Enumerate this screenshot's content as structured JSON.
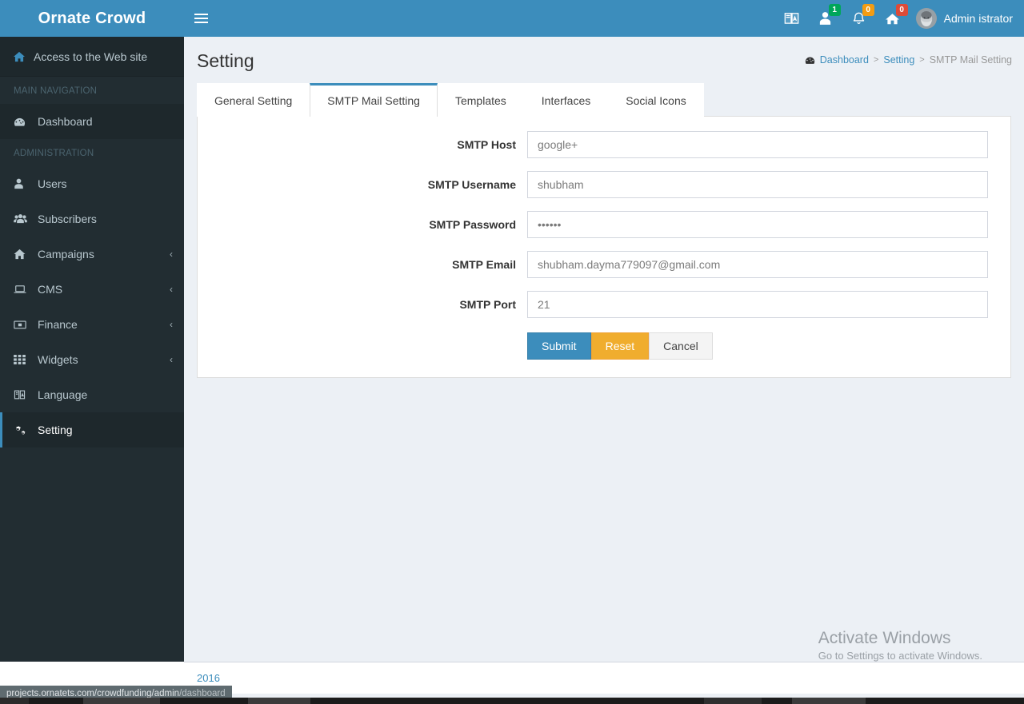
{
  "sidebar": {
    "brand": "Ornate Crowd",
    "web_access": {
      "label": "Access to the Web site",
      "icon": "home-icon"
    },
    "sections": [
      {
        "header": "MAIN NAVIGATION",
        "items": [
          {
            "label": "Dashboard",
            "icon": "dashboard-icon",
            "chevron": ""
          }
        ]
      },
      {
        "header": "ADMINISTRATION",
        "items": [
          {
            "label": "Users",
            "icon": "user-icon",
            "chevron": ""
          },
          {
            "label": "Subscribers",
            "icon": "users-group-icon",
            "chevron": ""
          },
          {
            "label": "Campaigns",
            "icon": "home-icon",
            "chevron": "‹"
          },
          {
            "label": "CMS",
            "icon": "laptop-icon",
            "chevron": "‹"
          },
          {
            "label": "Finance",
            "icon": "money-icon",
            "chevron": "‹"
          },
          {
            "label": "Widgets",
            "icon": "grid-icon",
            "chevron": "‹"
          },
          {
            "label": "Language",
            "icon": "language-icon",
            "chevron": ""
          },
          {
            "label": "Setting",
            "icon": "gears-icon",
            "chevron": "",
            "active": true
          }
        ]
      }
    ]
  },
  "navbar": {
    "menu_toggle_icon": "hamburger-icon",
    "icons": [
      {
        "name": "language-icon",
        "badge": null,
        "badge_color": null
      },
      {
        "name": "user-messages-icon",
        "badge": "1",
        "badge_color": "#00a65a"
      },
      {
        "name": "bell-icon",
        "badge": "0",
        "badge_color": "#f39c12"
      },
      {
        "name": "home-flag-icon",
        "badge": "0",
        "badge_color": "#dd4b39"
      }
    ],
    "user_name": "Admin istrator",
    "avatar_icon": "avatar"
  },
  "page": {
    "title": "Setting",
    "breadcrumb": {
      "home_icon": "dashboard-icon",
      "items": [
        {
          "label": "Dashboard",
          "current": false
        },
        {
          "label": "Setting",
          "current": false
        },
        {
          "label": "SMTP Mail Setting",
          "current": true
        }
      ],
      "separator": ">"
    }
  },
  "tabs": [
    {
      "label": "General Setting",
      "active": false
    },
    {
      "label": "SMTP Mail Setting",
      "active": true
    },
    {
      "label": "Templates",
      "active": false
    },
    {
      "label": "Interfaces",
      "active": false
    },
    {
      "label": "Social Icons",
      "active": false
    }
  ],
  "form": {
    "fields": [
      {
        "label": "SMTP Host",
        "value": "google+",
        "type": "text"
      },
      {
        "label": "SMTP Username",
        "value": "shubham",
        "type": "text"
      },
      {
        "label": "SMTP Password",
        "value": "••••••",
        "type": "password"
      },
      {
        "label": "SMTP Email",
        "value": "shubham.dayma779097@gmail.com",
        "type": "text"
      },
      {
        "label": "SMTP Port",
        "value": "21",
        "type": "text"
      }
    ],
    "buttons": [
      {
        "label": "Submit",
        "style": "primary"
      },
      {
        "label": "Reset",
        "style": "warning"
      },
      {
        "label": "Cancel",
        "style": "default"
      }
    ]
  },
  "footer": {
    "text": "2016"
  },
  "watermark": {
    "line1": "Activate Windows",
    "line2": "Go to Settings to activate Windows."
  },
  "statusbar": {
    "url_main": "projects.ornatets.com/crowdfunding/admin",
    "url_dim": "/dashboard"
  },
  "colors": {
    "brand_blue": "#3c8dbc",
    "sidebar_dark": "#222d32",
    "sidebar_dark_alt": "#1e282c",
    "content_bg": "#ecf0f5",
    "warning_orange": "#f0ad2e",
    "badge_green": "#00a65a",
    "badge_orange": "#f39c12",
    "badge_red": "#dd4b39"
  }
}
